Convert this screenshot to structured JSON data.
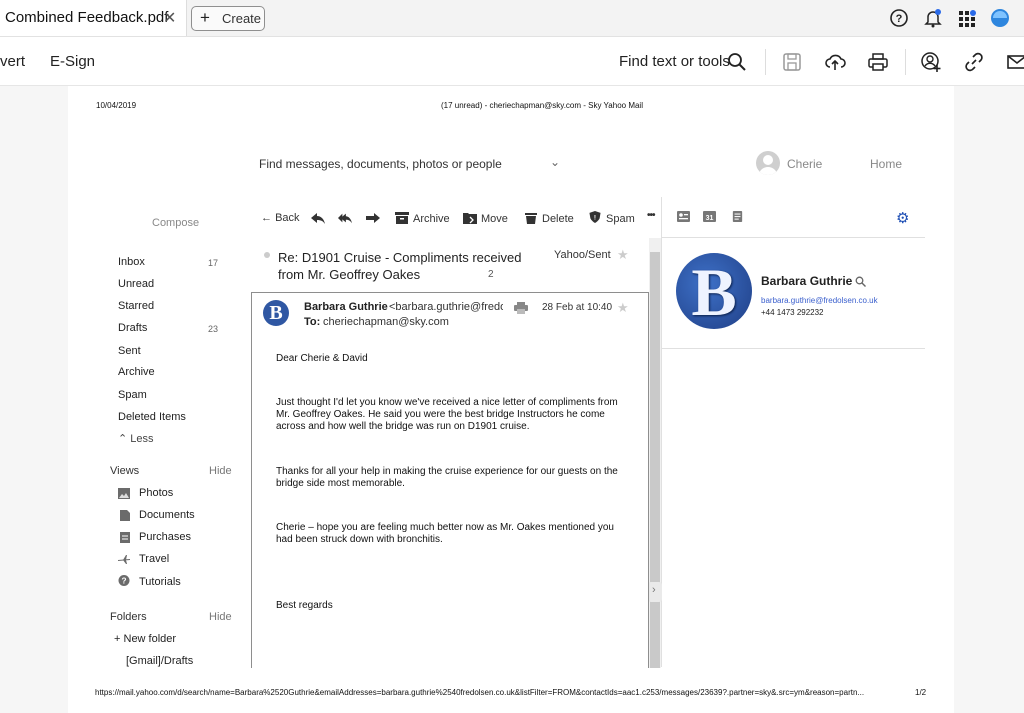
{
  "app": {
    "tab_title": "Combined Feedback.pdf",
    "create_label": "Create",
    "toolbar": {
      "convert_label": "vert",
      "esign_label": "E-Sign",
      "find_label": "Find text or tools"
    }
  },
  "print": {
    "date": "10/04/2019",
    "header": "(17 unread) - cheriechapman@sky.com - Sky Yahoo Mail",
    "footer_url": "https://mail.yahoo.com/d/search/name=Barbara%2520Guthrie&emailAddresses=barbara.guthrie%2540fredolsen.co.uk&listFilter=FROM&contactIds=aac1.c253/messages/23639?.partner=sky&.src=ym&reason=partn...",
    "footer_page": "1/2"
  },
  "mail": {
    "search_placeholder": "Find messages, documents, photos or people",
    "user_name": "Cherie",
    "home_label": "Home",
    "compose_label": "Compose",
    "nav": [
      {
        "label": "Inbox",
        "count": "17"
      },
      {
        "label": "Unread",
        "count": ""
      },
      {
        "label": "Starred",
        "count": ""
      },
      {
        "label": "Drafts",
        "count": "23"
      },
      {
        "label": "Sent",
        "count": ""
      },
      {
        "label": "Archive",
        "count": ""
      },
      {
        "label": "Spam",
        "count": ""
      },
      {
        "label": "Deleted Items",
        "count": ""
      }
    ],
    "less_label": "Less",
    "views_label": "Views",
    "views_hide": "Hide",
    "views": [
      {
        "label": "Photos",
        "icon": "photo-icon"
      },
      {
        "label": "Documents",
        "icon": "document-icon"
      },
      {
        "label": "Purchases",
        "icon": "receipt-icon"
      },
      {
        "label": "Travel",
        "icon": "plane-icon"
      },
      {
        "label": "Tutorials",
        "icon": "help-icon"
      }
    ],
    "folders_label": "Folders",
    "folders_hide": "Hide",
    "new_folder_label": "New folder",
    "folders": [
      "[Gmail]/Drafts"
    ],
    "message_toolbar": {
      "back": "Back",
      "archive": "Archive",
      "move": "Move",
      "delete": "Delete",
      "spam": "Spam",
      "more": "•••"
    },
    "subject": "Re: D1901 Cruise - Compliments received from Mr. Geoffrey Oakes",
    "thread_count": "2",
    "folder_label": "Yahoo/Sent",
    "message": {
      "sender_initial": "B",
      "sender_name": "Barbara Guthrie",
      "sender_email": "<barbara.guthrie@fredolsen.co.uk>",
      "to_label": "To:",
      "to_value": "cheriechapman@sky.com",
      "date": "28 Feb at 10:40",
      "body": {
        "greeting": "Dear Cherie & David",
        "p1": "Just thought I'd let you know we've received a nice letter of compliments from Mr. Geoffrey Oakes.  He said you were the best bridge Instructors he come across and how well the bridge was run on D1901 cruise.",
        "p2": "Thanks for all your help in making the cruise experience for our guests on the bridge side most memorable.",
        "p3": "Cherie – hope you are feeling much better now as Mr. Oakes mentioned you had been struck down with bronchitis.",
        "closing": "Best regards"
      }
    },
    "contact": {
      "initial": "B",
      "name": "Barbara Guthrie",
      "email": "barbara.guthrie@fredolsen.co.uk",
      "phone": "+44 1473 292232"
    }
  },
  "colors": {
    "accent_blue": "#1f4fb5",
    "link_blue": "#3a5fcd"
  }
}
